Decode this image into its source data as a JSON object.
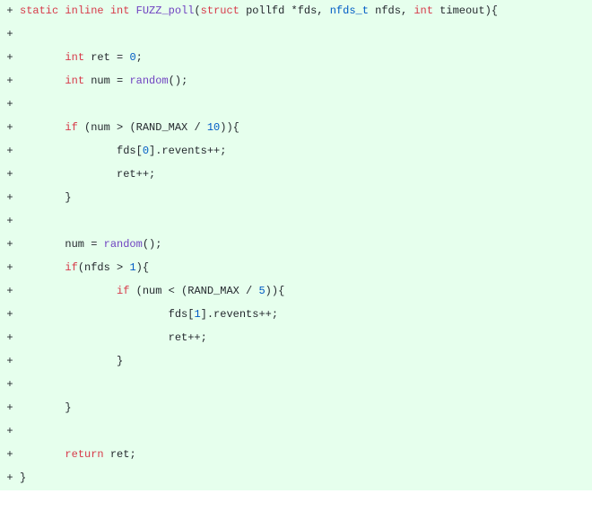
{
  "diff": {
    "marker": "+",
    "lines": [
      {
        "tokens": [
          {
            "t": "static ",
            "c": "kw"
          },
          {
            "t": "inline ",
            "c": "kw"
          },
          {
            "t": "int ",
            "c": "kw"
          },
          {
            "t": "FUZZ_poll",
            "c": "fn"
          },
          {
            "t": "(",
            "c": "pl"
          },
          {
            "t": "struct",
            "c": "kw"
          },
          {
            "t": " pollfd *fds, ",
            "c": "pl"
          },
          {
            "t": "nfds_t",
            "c": "ty"
          },
          {
            "t": " nfds, ",
            "c": "pl"
          },
          {
            "t": "int",
            "c": "kw"
          },
          {
            "t": " timeout){",
            "c": "pl"
          }
        ]
      },
      {
        "tokens": []
      },
      {
        "tokens": [
          {
            "t": "       ",
            "c": "pl"
          },
          {
            "t": "int",
            "c": "kw"
          },
          {
            "t": " ret = ",
            "c": "pl"
          },
          {
            "t": "0",
            "c": "num"
          },
          {
            "t": ";",
            "c": "pl"
          }
        ]
      },
      {
        "tokens": [
          {
            "t": "       ",
            "c": "pl"
          },
          {
            "t": "int",
            "c": "kw"
          },
          {
            "t": " num = ",
            "c": "pl"
          },
          {
            "t": "random",
            "c": "fn"
          },
          {
            "t": "();",
            "c": "pl"
          }
        ]
      },
      {
        "tokens": []
      },
      {
        "tokens": [
          {
            "t": "       ",
            "c": "pl"
          },
          {
            "t": "if",
            "c": "kw"
          },
          {
            "t": " (num > (RAND_MAX / ",
            "c": "pl"
          },
          {
            "t": "10",
            "c": "num"
          },
          {
            "t": ")){",
            "c": "pl"
          }
        ]
      },
      {
        "tokens": [
          {
            "t": "               fds[",
            "c": "pl"
          },
          {
            "t": "0",
            "c": "num"
          },
          {
            "t": "].revents++;",
            "c": "pl"
          }
        ]
      },
      {
        "tokens": [
          {
            "t": "               ret++;",
            "c": "pl"
          }
        ]
      },
      {
        "tokens": [
          {
            "t": "       }",
            "c": "pl"
          }
        ]
      },
      {
        "tokens": []
      },
      {
        "tokens": [
          {
            "t": "       num = ",
            "c": "pl"
          },
          {
            "t": "random",
            "c": "fn"
          },
          {
            "t": "();",
            "c": "pl"
          }
        ]
      },
      {
        "tokens": [
          {
            "t": "       ",
            "c": "pl"
          },
          {
            "t": "if",
            "c": "kw"
          },
          {
            "t": "(nfds > ",
            "c": "pl"
          },
          {
            "t": "1",
            "c": "num"
          },
          {
            "t": "){",
            "c": "pl"
          }
        ]
      },
      {
        "tokens": [
          {
            "t": "               ",
            "c": "pl"
          },
          {
            "t": "if",
            "c": "kw"
          },
          {
            "t": " (num < (RAND_MAX / ",
            "c": "pl"
          },
          {
            "t": "5",
            "c": "num"
          },
          {
            "t": ")){",
            "c": "pl"
          }
        ]
      },
      {
        "tokens": [
          {
            "t": "                       fds[",
            "c": "pl"
          },
          {
            "t": "1",
            "c": "num"
          },
          {
            "t": "].revents++;",
            "c": "pl"
          }
        ]
      },
      {
        "tokens": [
          {
            "t": "                       ret++;",
            "c": "pl"
          }
        ]
      },
      {
        "tokens": [
          {
            "t": "               }",
            "c": "pl"
          }
        ]
      },
      {
        "tokens": []
      },
      {
        "tokens": [
          {
            "t": "       }",
            "c": "pl"
          }
        ]
      },
      {
        "tokens": []
      },
      {
        "tokens": [
          {
            "t": "       ",
            "c": "pl"
          },
          {
            "t": "return",
            "c": "kw"
          },
          {
            "t": " ret;",
            "c": "pl"
          }
        ]
      },
      {
        "tokens": [
          {
            "t": "}",
            "c": "pl"
          }
        ]
      }
    ]
  }
}
